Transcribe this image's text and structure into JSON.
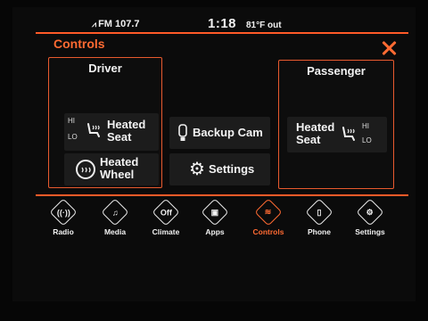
{
  "status": {
    "radio": "FM 107.7",
    "time": "1:18",
    "temperature": "81°F out"
  },
  "header": {
    "title": "Controls"
  },
  "driver": {
    "heading": "Driver",
    "heated_seat": {
      "label_line1": "Heated",
      "label_line2": "Seat",
      "hi": "HI",
      "lo": "LO"
    },
    "heated_wheel": {
      "label_line1": "Heated",
      "label_line2": "Wheel"
    }
  },
  "center": {
    "backup_cam": "Backup Cam",
    "settings": "Settings"
  },
  "passenger": {
    "heading": "Passenger",
    "heated_seat": {
      "label_line1": "Heated",
      "label_line2": "Seat",
      "hi": "HI",
      "lo": "LO"
    }
  },
  "nav": [
    {
      "label": "Radio",
      "icon": "radio-icon"
    },
    {
      "label": "Media",
      "icon": "media-icon"
    },
    {
      "label": "Climate",
      "icon": "climate-icon",
      "icon_text": "Off"
    },
    {
      "label": "Apps",
      "icon": "apps-icon"
    },
    {
      "label": "Controls",
      "icon": "controls-icon",
      "active": true
    },
    {
      "label": "Phone",
      "icon": "phone-icon"
    },
    {
      "label": "Settings",
      "icon": "gear-icon"
    }
  ],
  "colors": {
    "accent": "#ff6a32",
    "background": "#060606",
    "button": "#1c1c1c"
  }
}
